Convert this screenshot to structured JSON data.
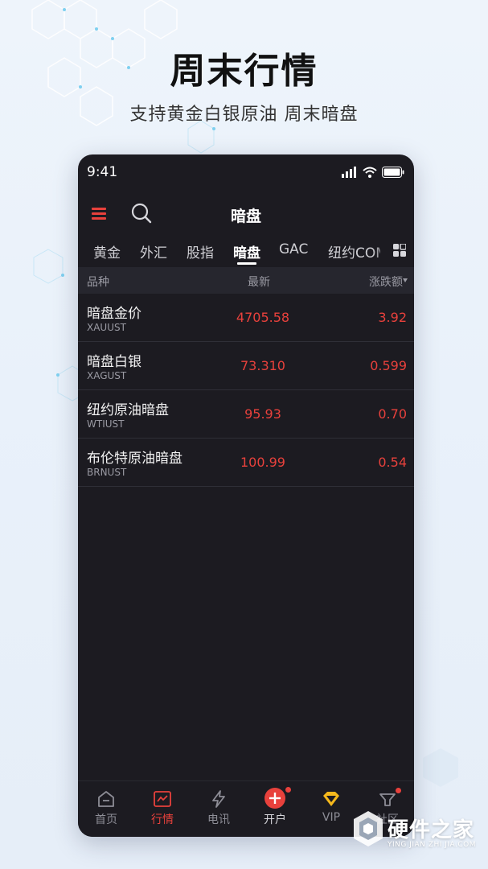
{
  "hero": {
    "title": "周末行情",
    "subtitle": "支持黄金白银原油 周末暗盘"
  },
  "status_bar": {
    "time": "9:41"
  },
  "nav": {
    "title": "暗盘"
  },
  "tabs": [
    {
      "label": "黄金",
      "active": false
    },
    {
      "label": "外汇",
      "active": false
    },
    {
      "label": "股指",
      "active": false
    },
    {
      "label": "暗盘",
      "active": true
    },
    {
      "label": "GAC",
      "active": false
    },
    {
      "label": "纽约COMEX",
      "active": false
    }
  ],
  "table": {
    "headers": {
      "name": "品种",
      "latest": "最新",
      "change": "涨跌额"
    },
    "rows": [
      {
        "name": "暗盘金价",
        "code": "XAUUST",
        "latest": "4705.58",
        "change": "3.92"
      },
      {
        "name": "暗盘白银",
        "code": "XAGUST",
        "latest": "73.310",
        "change": "0.599"
      },
      {
        "name": "纽约原油暗盘",
        "code": "WTIUST",
        "latest": "95.93",
        "change": "0.70"
      },
      {
        "name": "布伦特原油暗盘",
        "code": "BRNUST",
        "latest": "100.99",
        "change": "0.54"
      }
    ]
  },
  "bottom_nav": [
    {
      "label": "首页",
      "icon": "home-icon",
      "active": false
    },
    {
      "label": "行情",
      "icon": "chart-icon",
      "active": true
    },
    {
      "label": "电讯",
      "icon": "lightning-icon",
      "active": false
    },
    {
      "label": "开户",
      "icon": "plus-circle-icon",
      "active": false
    },
    {
      "label": "VIP",
      "icon": "diamond-icon",
      "active": false
    },
    {
      "label": "社区",
      "icon": "community-icon",
      "active": false
    }
  ],
  "watermark": {
    "main": "硬件之家",
    "sub": "YING JIAN ZHI JIA.COM"
  },
  "colors": {
    "accent_red": "#e8413c",
    "panel_bg": "#1c1b21",
    "header_bg": "#26262e",
    "vip_gold": "#f5b81c"
  }
}
